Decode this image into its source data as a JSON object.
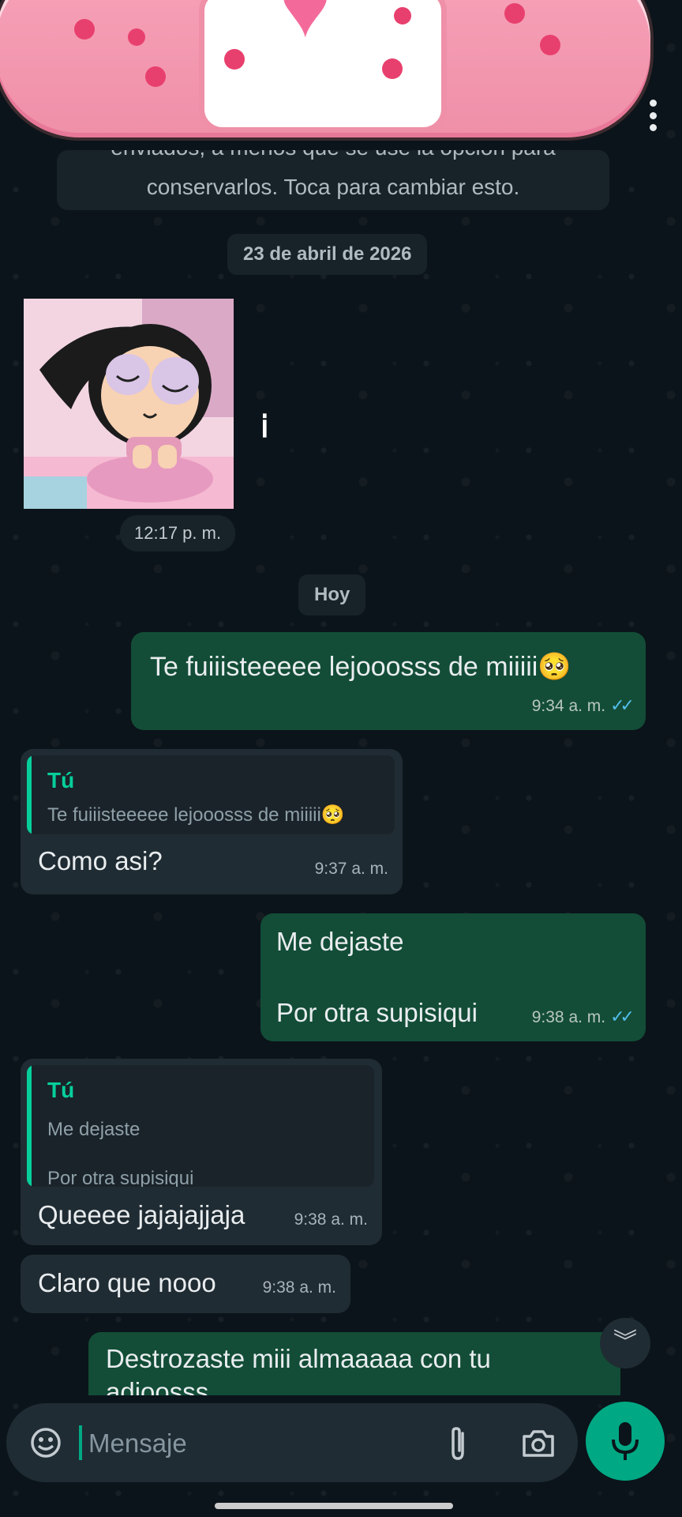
{
  "header": {
    "menu_icon": "more-vert-icon"
  },
  "system_notice": {
    "line1": "enviados, a menos que se use la opción para",
    "line2": "conservarlos. Toca para cambiar esto."
  },
  "date_separators": {
    "first": "23 de abril de 2026",
    "today": "Hoy"
  },
  "image_message": {
    "time": "12:17 p. m.",
    "download_icon": "info-download-icon"
  },
  "messages": [
    {
      "type": "out",
      "text": "Te fuiiisteeeee lejooosss de miiiii🥺",
      "time": "9:34 a. m.",
      "status": "read"
    },
    {
      "type": "in",
      "quote_author": "Tú",
      "quote_text": "Te fuiiisteeeee lejooosss de miiiii🥺",
      "text": "Como asi?",
      "time": "9:37 a. m."
    },
    {
      "type": "out",
      "line1": "Me dejaste",
      "line2": "Por otra supisiqui",
      "time": "9:38 a. m.",
      "status": "read"
    },
    {
      "type": "in",
      "quote_author": "Tú",
      "quote_line1": "Me dejaste",
      "quote_line2": "Por otra supisiqui",
      "text": "Queeee jajajajjaja",
      "time": "9:38 a. m."
    },
    {
      "type": "in",
      "text": "Claro que nooo",
      "time": "9:38 a. m."
    },
    {
      "type": "out",
      "line1": "Destrozaste miii almaaaaa con tu",
      "line2": "adioosss"
    }
  ],
  "composer": {
    "placeholder": "Mensaje",
    "icons": [
      "emoji-icon",
      "attach-icon",
      "camera-icon",
      "mic-icon"
    ]
  },
  "colors": {
    "outgoing_bubble": "#134d37",
    "incoming_bubble": "#202c33",
    "accent": "#00a884",
    "read_ticks": "#53bdeb",
    "quote_bar": "#06cf9c"
  }
}
